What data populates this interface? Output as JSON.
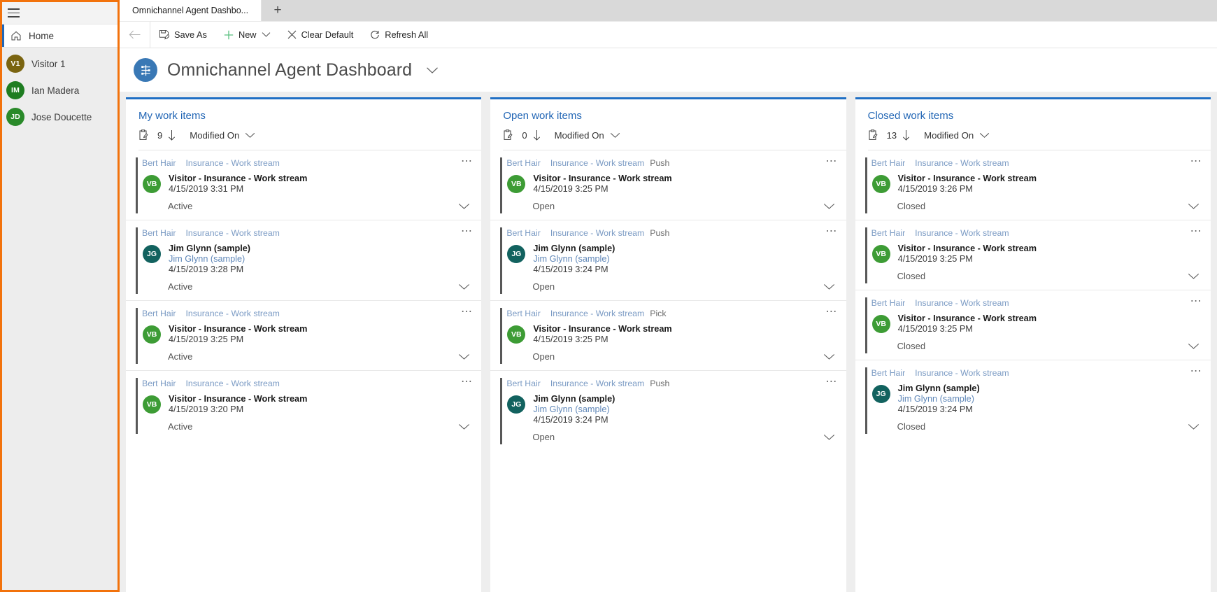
{
  "sidebar": {
    "hamburger_icon": "hamburger-icon",
    "home": {
      "label": "Home",
      "icon": "home-icon"
    },
    "people": [
      {
        "initials": "V1",
        "name": "Visitor 1",
        "color": "#7a6410"
      },
      {
        "initials": "IM",
        "name": "Ian Madera",
        "color": "#1e7d21"
      },
      {
        "initials": "JD",
        "name": "Jose Doucette",
        "color": "#2a8a2a"
      }
    ]
  },
  "tabstrip": {
    "active_tab": "Omnichannel Agent Dashbo...",
    "new_tab_label": "+"
  },
  "commandbar": {
    "back_icon": "back-arrow-icon",
    "buttons": [
      {
        "label": "Save As",
        "icon": "save-as-icon"
      },
      {
        "label": "New",
        "icon": "plus-icon",
        "has_chevron": true
      },
      {
        "label": "Clear Default",
        "icon": "close-x-icon"
      },
      {
        "label": "Refresh All",
        "icon": "refresh-icon"
      }
    ]
  },
  "page": {
    "icon": "dashboard-icon",
    "title": "Omnichannel Agent Dashboard",
    "chevron_icon": "chevron-down-icon"
  },
  "panels": [
    {
      "title": "My work items",
      "count": "9",
      "sort_icon": "sort-down-arrow-icon",
      "sort_label": "Modified On",
      "list_icon": "clipboard-icon",
      "chevron_icon": "chevron-down-icon",
      "accent": "#1f6fc4",
      "cards": [
        {
          "owner": "Bert Hair",
          "stream": "Insurance - Work stream",
          "mode": "",
          "initials": "VB",
          "avatar_color": "#3d9c35",
          "primary": "Visitor - Insurance - Work stream",
          "sub": "",
          "time": "4/15/2019 3:31 PM",
          "status": "Active"
        },
        {
          "owner": "Bert Hair",
          "stream": "Insurance - Work stream",
          "mode": "",
          "initials": "JG",
          "avatar_color": "#12625f",
          "primary": "Jim Glynn (sample)",
          "sub": "Jim Glynn (sample)",
          "time": "4/15/2019 3:28 PM",
          "status": "Active"
        },
        {
          "owner": "Bert Hair",
          "stream": "Insurance - Work stream",
          "mode": "",
          "initials": "VB",
          "avatar_color": "#3d9c35",
          "primary": "Visitor - Insurance - Work stream",
          "sub": "",
          "time": "4/15/2019 3:25 PM",
          "status": "Active"
        },
        {
          "owner": "Bert Hair",
          "stream": "Insurance - Work stream",
          "mode": "",
          "initials": "VB",
          "avatar_color": "#3d9c35",
          "primary": "Visitor - Insurance - Work stream",
          "sub": "",
          "time": "4/15/2019 3:20 PM",
          "status": "Active"
        }
      ]
    },
    {
      "title": "Open work items",
      "count": "0",
      "sort_icon": "sort-down-arrow-icon",
      "sort_label": "Modified On",
      "list_icon": "clipboard-icon",
      "chevron_icon": "chevron-down-icon",
      "accent": "#1f6fc4",
      "cards": [
        {
          "owner": "Bert Hair",
          "stream": "Insurance - Work stream",
          "mode": "Push",
          "initials": "VB",
          "avatar_color": "#3d9c35",
          "primary": "Visitor - Insurance - Work stream",
          "sub": "",
          "time": "4/15/2019 3:25 PM",
          "status": "Open"
        },
        {
          "owner": "Bert Hair",
          "stream": "Insurance - Work stream",
          "mode": "Push",
          "initials": "JG",
          "avatar_color": "#12625f",
          "primary": "Jim Glynn (sample)",
          "sub": "Jim Glynn (sample)",
          "time": "4/15/2019 3:24 PM",
          "status": "Open"
        },
        {
          "owner": "Bert Hair",
          "stream": "Insurance - Work stream",
          "mode": "Pick",
          "initials": "VB",
          "avatar_color": "#3d9c35",
          "primary": "Visitor - Insurance - Work stream",
          "sub": "",
          "time": "4/15/2019 3:25 PM",
          "status": "Open"
        },
        {
          "owner": "Bert Hair",
          "stream": "Insurance - Work stream",
          "mode": "Push",
          "initials": "JG",
          "avatar_color": "#12625f",
          "primary": "Jim Glynn (sample)",
          "sub": "Jim Glynn (sample)",
          "time": "4/15/2019 3:24 PM",
          "status": "Open"
        }
      ]
    },
    {
      "title": "Closed work items",
      "count": "13",
      "sort_icon": "sort-down-arrow-icon",
      "sort_label": "Modified On",
      "list_icon": "clipboard-icon",
      "chevron_icon": "chevron-down-icon",
      "accent": "#1f6fc4",
      "cards": [
        {
          "owner": "Bert Hair",
          "stream": "Insurance - Work stream",
          "mode": "",
          "initials": "VB",
          "avatar_color": "#3d9c35",
          "primary": "Visitor - Insurance - Work stream",
          "sub": "",
          "time": "4/15/2019 3:26 PM",
          "status": "Closed"
        },
        {
          "owner": "Bert Hair",
          "stream": "Insurance - Work stream",
          "mode": "",
          "initials": "VB",
          "avatar_color": "#3d9c35",
          "primary": "Visitor - Insurance - Work stream",
          "sub": "",
          "time": "4/15/2019 3:25 PM",
          "status": "Closed"
        },
        {
          "owner": "Bert Hair",
          "stream": "Insurance - Work stream",
          "mode": "",
          "initials": "VB",
          "avatar_color": "#3d9c35",
          "primary": "Visitor - Insurance - Work stream",
          "sub": "",
          "time": "4/15/2019 3:25 PM",
          "status": "Closed"
        },
        {
          "owner": "Bert Hair",
          "stream": "Insurance - Work stream",
          "mode": "",
          "initials": "JG",
          "avatar_color": "#12625f",
          "primary": "Jim Glynn (sample)",
          "sub": "Jim Glynn (sample)",
          "time": "4/15/2019 3:24 PM",
          "status": "Closed"
        }
      ]
    }
  ]
}
